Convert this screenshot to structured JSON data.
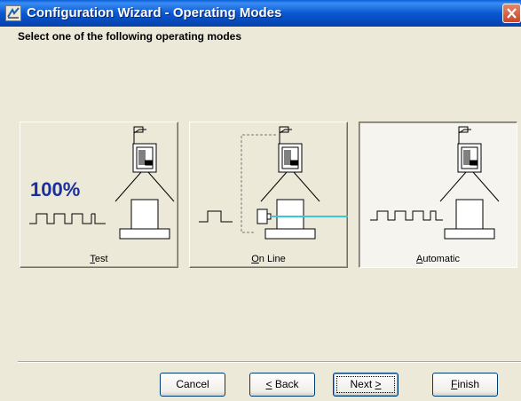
{
  "window": {
    "title": "Configuration Wizard - Operating Modes",
    "close_icon": "close-icon",
    "app_icon": "wizard-icon"
  },
  "heading": "Select one of the following operating modes",
  "modes": [
    {
      "label_accel": "T",
      "label_rest": "est",
      "badge": "100%",
      "selected": false
    },
    {
      "label_accel": "O",
      "label_rest": "n Line",
      "selected": false
    },
    {
      "label_accel": "A",
      "label_rest": "utomatic",
      "selected": true
    }
  ],
  "buttons": {
    "cancel": "Cancel",
    "back_accel": "<",
    "back_pre": "",
    "back_post": "Back",
    "next_pre": "Next ",
    "next_accel": ">",
    "finish_accel": "F",
    "finish_rest": "inish"
  },
  "colors": {
    "accent_blue": "#1a2f9c",
    "beam": "#39c7d9",
    "titlebar": "#0a58d2"
  }
}
